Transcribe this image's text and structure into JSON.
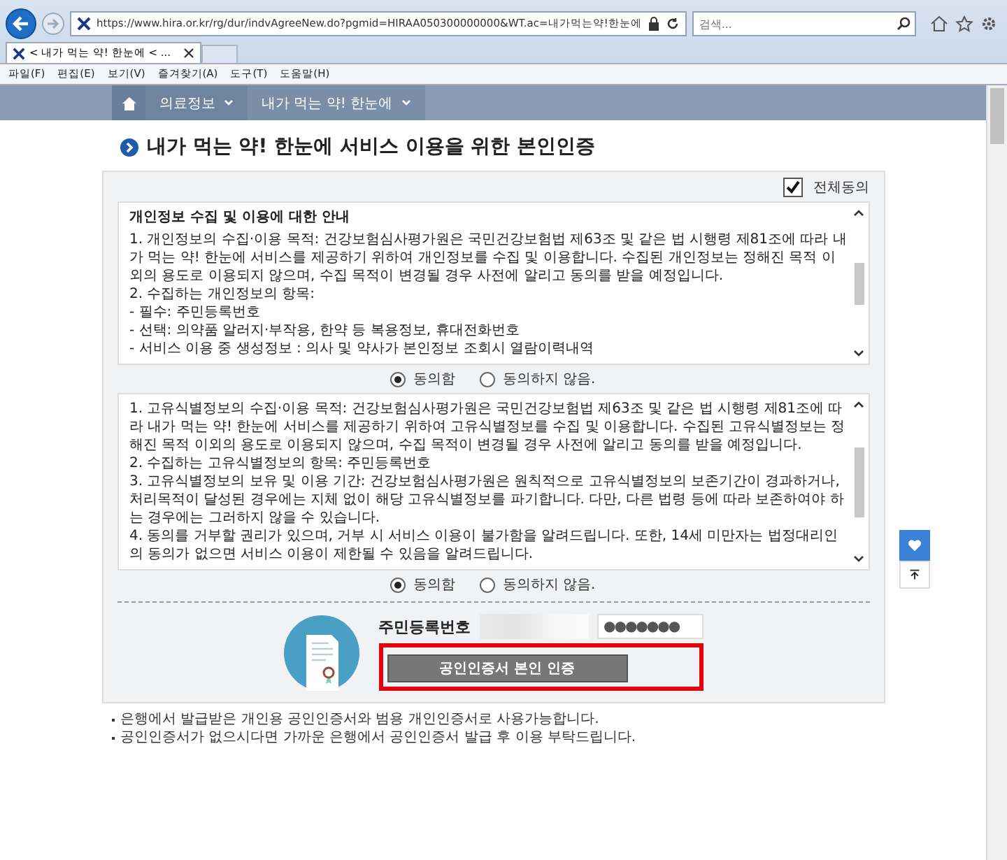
{
  "browser": {
    "url": "https://www.hira.or.kr/rg/dur/indvAgreeNew.do?pgmid=HIRAA050300000000&WT.ac=내가먹는약!한눈에",
    "search_placeholder": "검색...",
    "tab_title": "< 내가 먹는 약! 한눈에 < ...",
    "menu": [
      "파일(F)",
      "편집(E)",
      "보기(V)",
      "즐겨찾기(A)",
      "도구(T)",
      "도움말(H)"
    ]
  },
  "nav": [
    {
      "kind": "home"
    },
    {
      "kind": "menu",
      "label": "의료정보"
    },
    {
      "kind": "menu",
      "label": "내가 먹는 약! 한눈에"
    }
  ],
  "page_title": "내가 먹는 약! 한눈에 서비스 이용을 위한 본인인증",
  "agree_all": {
    "label": "전체동의",
    "checked": true
  },
  "sections": [
    {
      "heading": "개인정보 수집 및 이용에 대한 안내",
      "lines": [
        "1. 개인정보의 수집·이용 목적: 건강보험심사평가원은 국민건강보험법 제63조 및 같은 법 시행령 제81조에 따라 내가 먹는 약! 한눈에 서비스를 제공하기 위하여 개인정보를 수집 및 이용합니다. 수집된 개인정보는 정해진 목적 이외의 용도로 이용되지 않으며, 수집 목적이 변경될 경우 사전에 알리고 동의를 받을 예정입니다.",
        "2. 수집하는 개인정보의 항목:",
        "- 필수: 주민등록번호",
        "- 선택: 의약품 알러지·부작용, 한약 등 복용정보, 휴대전화번호",
        "- 서비스 이용 중 생성정보 : 의사 및 약사가 본인정보 조회시 열람이력내역"
      ],
      "radios": [
        {
          "label": "동의함",
          "selected": true
        },
        {
          "label": "동의하지 않음.",
          "selected": false
        }
      ]
    },
    {
      "lines": [
        "1. 고유식별정보의 수집·이용 목적: 건강보험심사평가원은 국민건강보험법 제63조 및 같은 법 시행령 제81조에 따라 내가 먹는 약! 한눈에 서비스를 제공하기 위하여 고유식별정보를 수집 및 이용합니다. 수집된 고유식별정보는 정해진 목적 이외의 용도로 이용되지 않으며, 수집 목적이 변경될 경우 사전에 알리고 동의를 받을 예정입니다.",
        "2. 수집하는 고유식별정보의 항목: 주민등록번호",
        "3. 고유식별정보의 보유 및 이용 기간: 건강보험심사평가원은 원칙적으로 고유식별정보의 보존기간이 경과하거나, 처리목적이 달성된 경우에는 지체 없이 해당 고유식별정보를 파기합니다. 다만, 다른 법령 등에 따라 보존하여야 하는 경우에는 그러하지 않을 수 있습니다.",
        "4. 동의를 거부할 권리가 있으며, 거부 시 서비스 이용이 불가함을 알려드립니다. 또한, 14세 미만자는 법정대리인의 동의가 없으면 서비스 이용이 제한될 수 있음을 알려드립니다."
      ],
      "radios": [
        {
          "label": "동의함",
          "selected": true
        },
        {
          "label": "동의하지 않음.",
          "selected": false
        }
      ]
    }
  ],
  "id_form": {
    "label": "주민등록번호",
    "masked_value": "●●●●●●●",
    "button": "공인인증서 본인 인증"
  },
  "notes": [
    "은행에서 발급받은 개인용 공인인증서와 범용 개인인증서로 사용가능합니다.",
    "공인인증서가 없으시다면 가까운 은행에서 공인인증서 발급 후 이용 부탁드립니다."
  ]
}
